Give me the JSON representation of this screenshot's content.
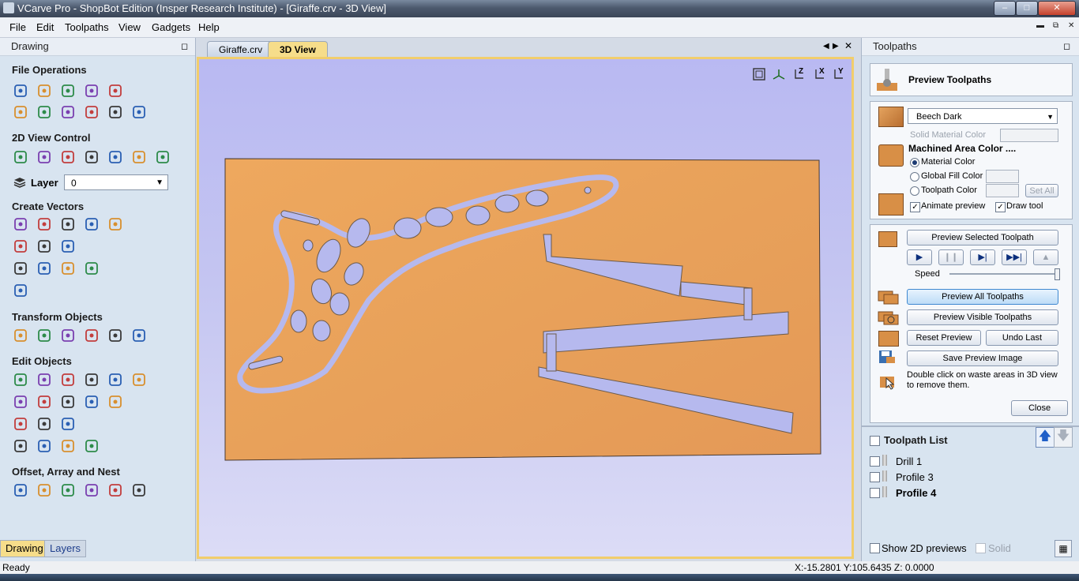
{
  "window": {
    "title": "VCarve Pro - ShopBot Edition (Insper Research Institute) - [Giraffe.crv - 3D View]"
  },
  "menu": [
    "File",
    "Edit",
    "Toolpaths",
    "View",
    "Gadgets",
    "Help"
  ],
  "left_panel": {
    "title": "Drawing",
    "sections": {
      "file_operations": "File Operations",
      "view_control": "2D View Control",
      "layer_label": "Layer",
      "layer_value": "0",
      "create_vectors": "Create Vectors",
      "transform": "Transform Objects",
      "edit": "Edit Objects",
      "offset": "Offset, Array and Nest"
    },
    "bottom_tabs": [
      "Drawing",
      "Layers"
    ]
  },
  "doc_tabs": [
    "Giraffe.crv",
    "3D View"
  ],
  "active_tab": "3D View",
  "view_buttons": [
    "zoom-extents-icon",
    "view-iso-icon",
    "view-z-icon",
    "view-x-icon",
    "view-y-icon"
  ],
  "view_axis_labels": [
    "Z",
    "X",
    "Y"
  ],
  "right_panel": {
    "title": "Toolpaths",
    "header": "Preview Toolpaths",
    "material": "Beech Dark",
    "solid_material_color": "Solid Material Color",
    "machined_area_color": "Machined Area Color ....",
    "radio_material": "Material Color",
    "radio_global": "Global Fill Color",
    "radio_toolpath": "Toolpath Color",
    "set_all": "Set All",
    "animate_preview": "Animate preview",
    "draw_tool": "Draw tool",
    "preview_selected": "Preview Selected Toolpath",
    "speed": "Speed",
    "speed_value": 1.0,
    "preview_all": "Preview All Toolpaths",
    "preview_visible": "Preview Visible Toolpaths",
    "reset_preview": "Reset Preview",
    "undo_last": "Undo Last",
    "save_preview": "Save Preview Image",
    "hint": "Double click on waste areas in 3D view to remove them.",
    "close": "Close",
    "list_title": "Toolpath List",
    "toolpaths": [
      "Drill 1",
      "Profile 3",
      "Profile 4"
    ],
    "show_2d_previews": "Show 2D previews",
    "solid": "Solid"
  },
  "status": {
    "left": "Ready",
    "coords": "X:-15.2801 Y:105.6435 Z: 0.0000"
  },
  "colors": {
    "wood": "#e9a25a",
    "cut": "#b6b9ee",
    "tab_active": "#f6dd8a"
  }
}
